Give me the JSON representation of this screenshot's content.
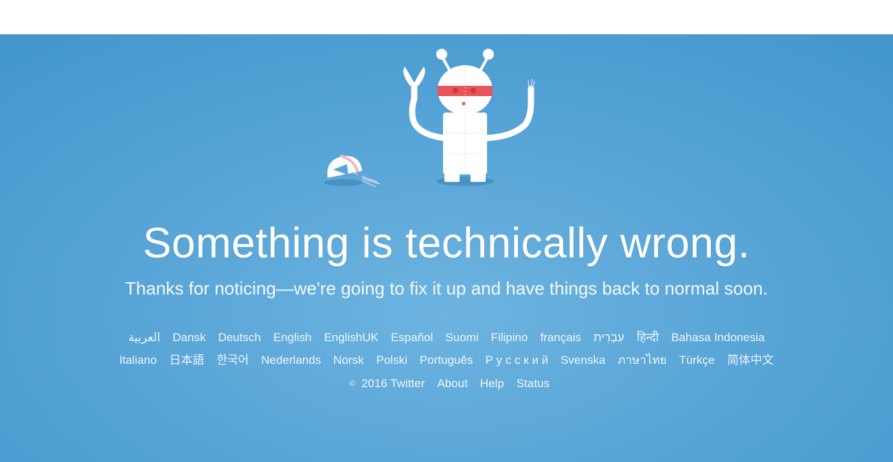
{
  "error": {
    "headline": "Something is technically wrong.",
    "subtext": "Thanks for noticing—we're going to fix it up and have things back to normal soon."
  },
  "languages": {
    "row1": [
      "العربية",
      "Dansk",
      "Deutsch",
      "English",
      "EnglishUK",
      "Español",
      "Suomi",
      "Filipino",
      "français",
      "עִבְרִית",
      "हिन्दी",
      "Bahasa Indonesia"
    ],
    "row2": [
      "Italiano",
      "日本語",
      "한국어",
      "Nederlands",
      "Norsk",
      "Polski",
      "Português",
      "Р у с с к и й",
      "Svenska",
      "ภาษาไทย",
      "Türkçe",
      "简体中文"
    ]
  },
  "footer": {
    "copyright_symbol": "©",
    "copyright": "2016 Twitter",
    "about": "About",
    "help": "Help",
    "status": "Status"
  },
  "colors": {
    "background": "#5aa6d8",
    "text": "#ffffff",
    "robot_mask": "#e8555a"
  },
  "illustration": {
    "name": "broken-robot-illustration"
  }
}
